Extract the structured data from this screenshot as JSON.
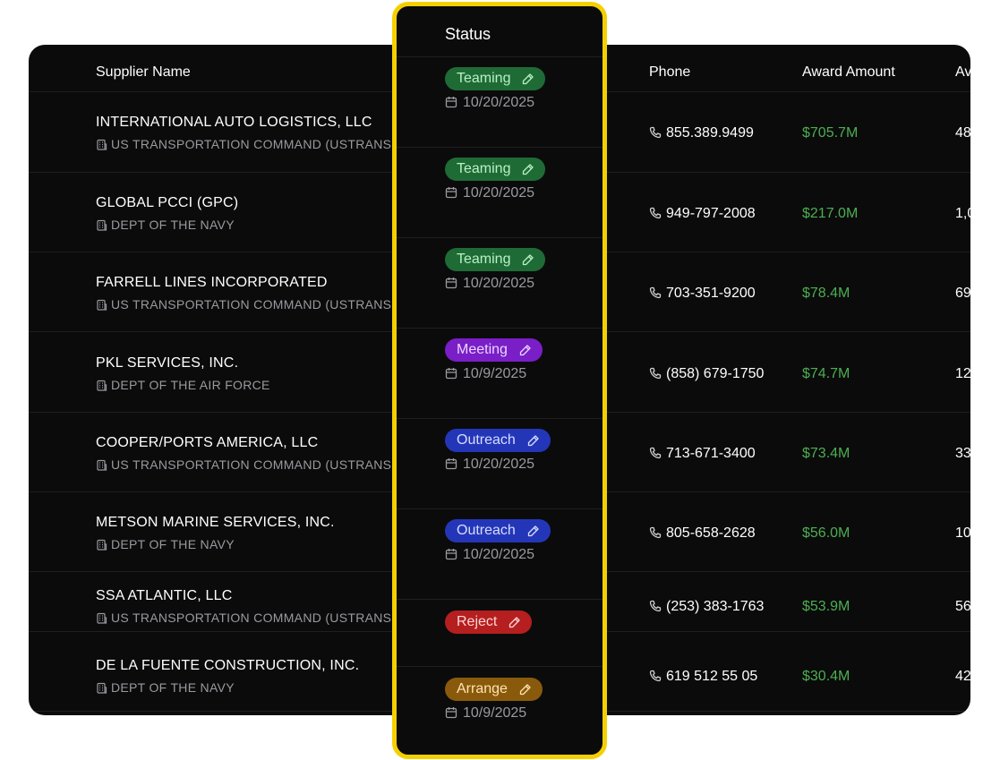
{
  "table": {
    "headers": {
      "supplier": "Supplier Name",
      "phone": "Phone",
      "award": "Award Amount",
      "next": "Av"
    },
    "rows": [
      {
        "name": "INTERNATIONAL AUTO LOGISTICS, LLC",
        "agency": "US TRANSPORTATION COMMAND (USTRANSC",
        "frag": ")",
        "phone": "855.389.9499",
        "award": "$705.7M",
        "next": "48"
      },
      {
        "name": "GLOBAL PCCI (GPC)",
        "agency": "DEPT OF THE NAVY",
        "frag": "",
        "phone": "949-797-2008",
        "award": "$217.0M",
        "next": "1,0"
      },
      {
        "name": "FARRELL LINES INCORPORATED",
        "agency": "US TRANSPORTATION COMMAND (USTRANSC",
        "frag": ")",
        "phone": "703-351-9200",
        "award": "$78.4M",
        "next": "69"
      },
      {
        "name": "PKL SERVICES, INC.",
        "agency": "DEPT OF THE AIR FORCE",
        "frag": "",
        "phone": "(858) 679-1750",
        "award": "$74.7M",
        "next": "12"
      },
      {
        "name": "COOPER/PORTS AMERICA, LLC",
        "agency": "US TRANSPORTATION COMMAND (USTRANSC",
        "frag": ")",
        "phone": "713-671-3400",
        "award": "$73.4M",
        "next": "33"
      },
      {
        "name": "METSON MARINE SERVICES, INC.",
        "agency": "DEPT OF THE NAVY",
        "frag": "",
        "phone": "805-658-2628",
        "award": "$56.0M",
        "next": "10"
      },
      {
        "name": "SSA ATLANTIC, LLC",
        "agency": "US TRANSPORTATION COMMAND (USTRANSC",
        "frag": ")",
        "phone": "(253) 383-1763",
        "award": "$53.9M",
        "next": "56"
      },
      {
        "name": "DE LA FUENTE CONSTRUCTION, INC.",
        "agency": "DEPT OF THE NAVY",
        "frag": "",
        "phone": "619 512 55 05",
        "award": "$30.4M",
        "next": "42"
      }
    ]
  },
  "status_panel": {
    "header": "Status",
    "items": [
      {
        "label": "Teaming",
        "date": "10/20/2025",
        "kind": "teaming"
      },
      {
        "label": "Teaming",
        "date": "10/20/2025",
        "kind": "teaming"
      },
      {
        "label": "Teaming",
        "date": "10/20/2025",
        "kind": "teaming"
      },
      {
        "label": "Meeting",
        "date": "10/9/2025",
        "kind": "meeting"
      },
      {
        "label": "Outreach",
        "date": "10/20/2025",
        "kind": "outreach"
      },
      {
        "label": "Outreach",
        "date": "10/20/2025",
        "kind": "outreach"
      },
      {
        "label": "Reject",
        "date": "",
        "kind": "reject"
      },
      {
        "label": "Arrange",
        "date": "10/9/2025",
        "kind": "arrange"
      }
    ]
  },
  "icons": {
    "agency": "building-icon",
    "phone": "phone-icon",
    "date": "calendar-icon",
    "edit": "pencil-icon"
  },
  "colors": {
    "highlight_border": "#f5d000",
    "award_green": "#4caf50",
    "teaming": "#1f6b36",
    "meeting": "#7a1ec7",
    "outreach": "#2436b8",
    "reject": "#b51f1f",
    "arrange": "#8a5a0c"
  }
}
